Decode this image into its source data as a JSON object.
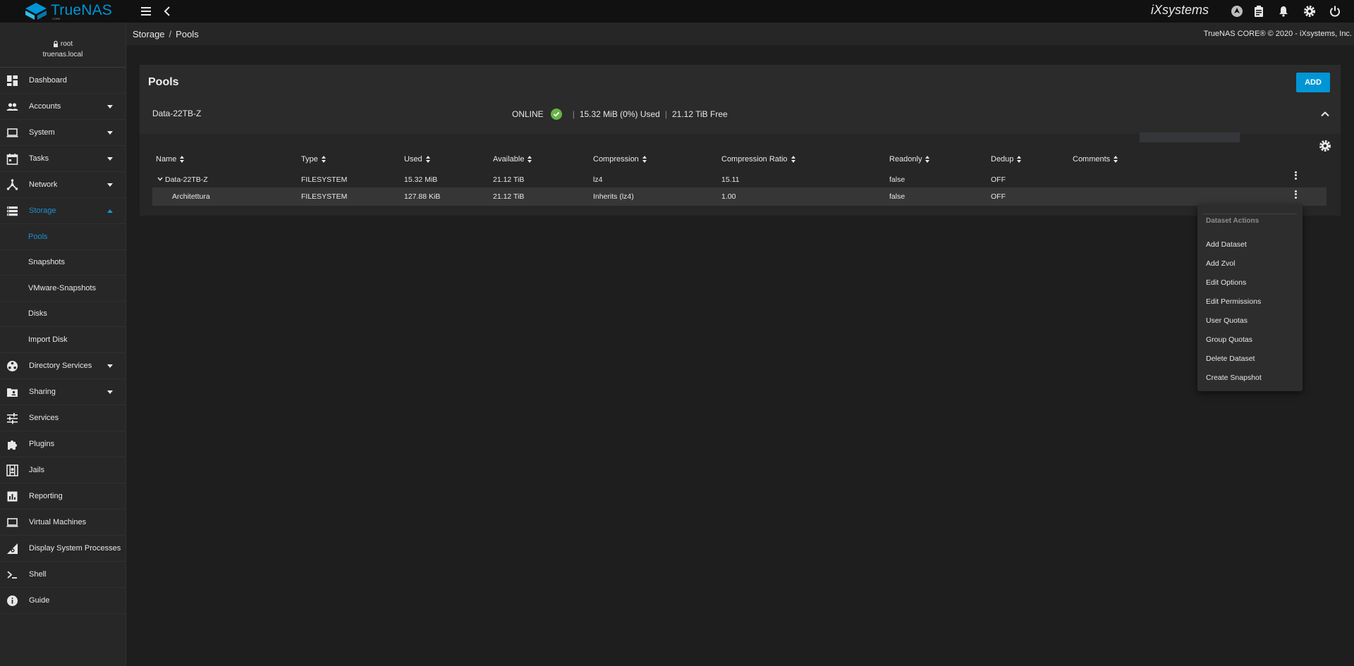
{
  "app": {
    "brand": "TrueNAS",
    "edition": "CORE",
    "vendor_logo": "iXsystems"
  },
  "user": {
    "name": "root",
    "host": "truenas.local"
  },
  "sidebar": {
    "items": [
      {
        "label": "Dashboard",
        "icon": "dashboard-icon"
      },
      {
        "label": "Accounts",
        "icon": "people-icon"
      },
      {
        "label": "System",
        "icon": "laptop-icon"
      },
      {
        "label": "Tasks",
        "icon": "calendar-icon"
      },
      {
        "label": "Network",
        "icon": "network-icon"
      },
      {
        "label": "Storage",
        "icon": "storage-icon"
      },
      {
        "label": "Directory Services",
        "icon": "directory-icon"
      },
      {
        "label": "Sharing",
        "icon": "folder-shared-icon"
      },
      {
        "label": "Services",
        "icon": "tune-icon"
      },
      {
        "label": "Plugins",
        "icon": "puzzle-icon"
      },
      {
        "label": "Jails",
        "icon": "jails-icon"
      },
      {
        "label": "Reporting",
        "icon": "chart-icon"
      },
      {
        "label": "Virtual Machines",
        "icon": "computer-icon"
      },
      {
        "label": "Display System Processes",
        "icon": "processes-icon"
      },
      {
        "label": "Shell",
        "icon": "terminal-icon"
      },
      {
        "label": "Guide",
        "icon": "info-icon"
      }
    ],
    "storage_sub": [
      "Pools",
      "Snapshots",
      "VMware-Snapshots",
      "Disks",
      "Import Disk"
    ]
  },
  "breadcrumb": {
    "parent": "Storage",
    "current": "Pools",
    "separator": "/"
  },
  "copyright": "TrueNAS CORE® © 2020 - iXsystems, Inc.",
  "card": {
    "title": "Pools",
    "add_label": "ADD"
  },
  "pool": {
    "name": "Data-22TB-Z",
    "status": "ONLINE",
    "used": "15.32 MiB (0%) Used",
    "free": "21.12 TiB Free",
    "status_color": "#67b346"
  },
  "table": {
    "columns": [
      "Name",
      "Type",
      "Used",
      "Available",
      "Compression",
      "Compression Ratio",
      "Readonly",
      "Dedup",
      "Comments"
    ],
    "rows": [
      {
        "name": "Data-22TB-Z",
        "type": "FILESYSTEM",
        "used": "15.32 MiB",
        "available": "21.12 TiB",
        "compression": "lz4",
        "ratio": "15.11",
        "readonly": "false",
        "dedup": "OFF",
        "comments": ""
      },
      {
        "name": "Architettura",
        "type": "FILESYSTEM",
        "used": "127.88 KiB",
        "available": "21.12 TiB",
        "compression": "Inherits (lz4)",
        "ratio": "1.00",
        "readonly": "false",
        "dedup": "OFF",
        "comments": ""
      }
    ]
  },
  "menu": {
    "title": "Dataset Actions",
    "items": [
      "Add Dataset",
      "Add Zvol",
      "Edit Options",
      "Edit Permissions",
      "User Quotas",
      "Group Quotas",
      "Delete Dataset",
      "Create Snapshot"
    ]
  },
  "colors": {
    "accent": "#0095d5",
    "active_nav": "#1e90d0",
    "background": "#1e1e1e"
  }
}
